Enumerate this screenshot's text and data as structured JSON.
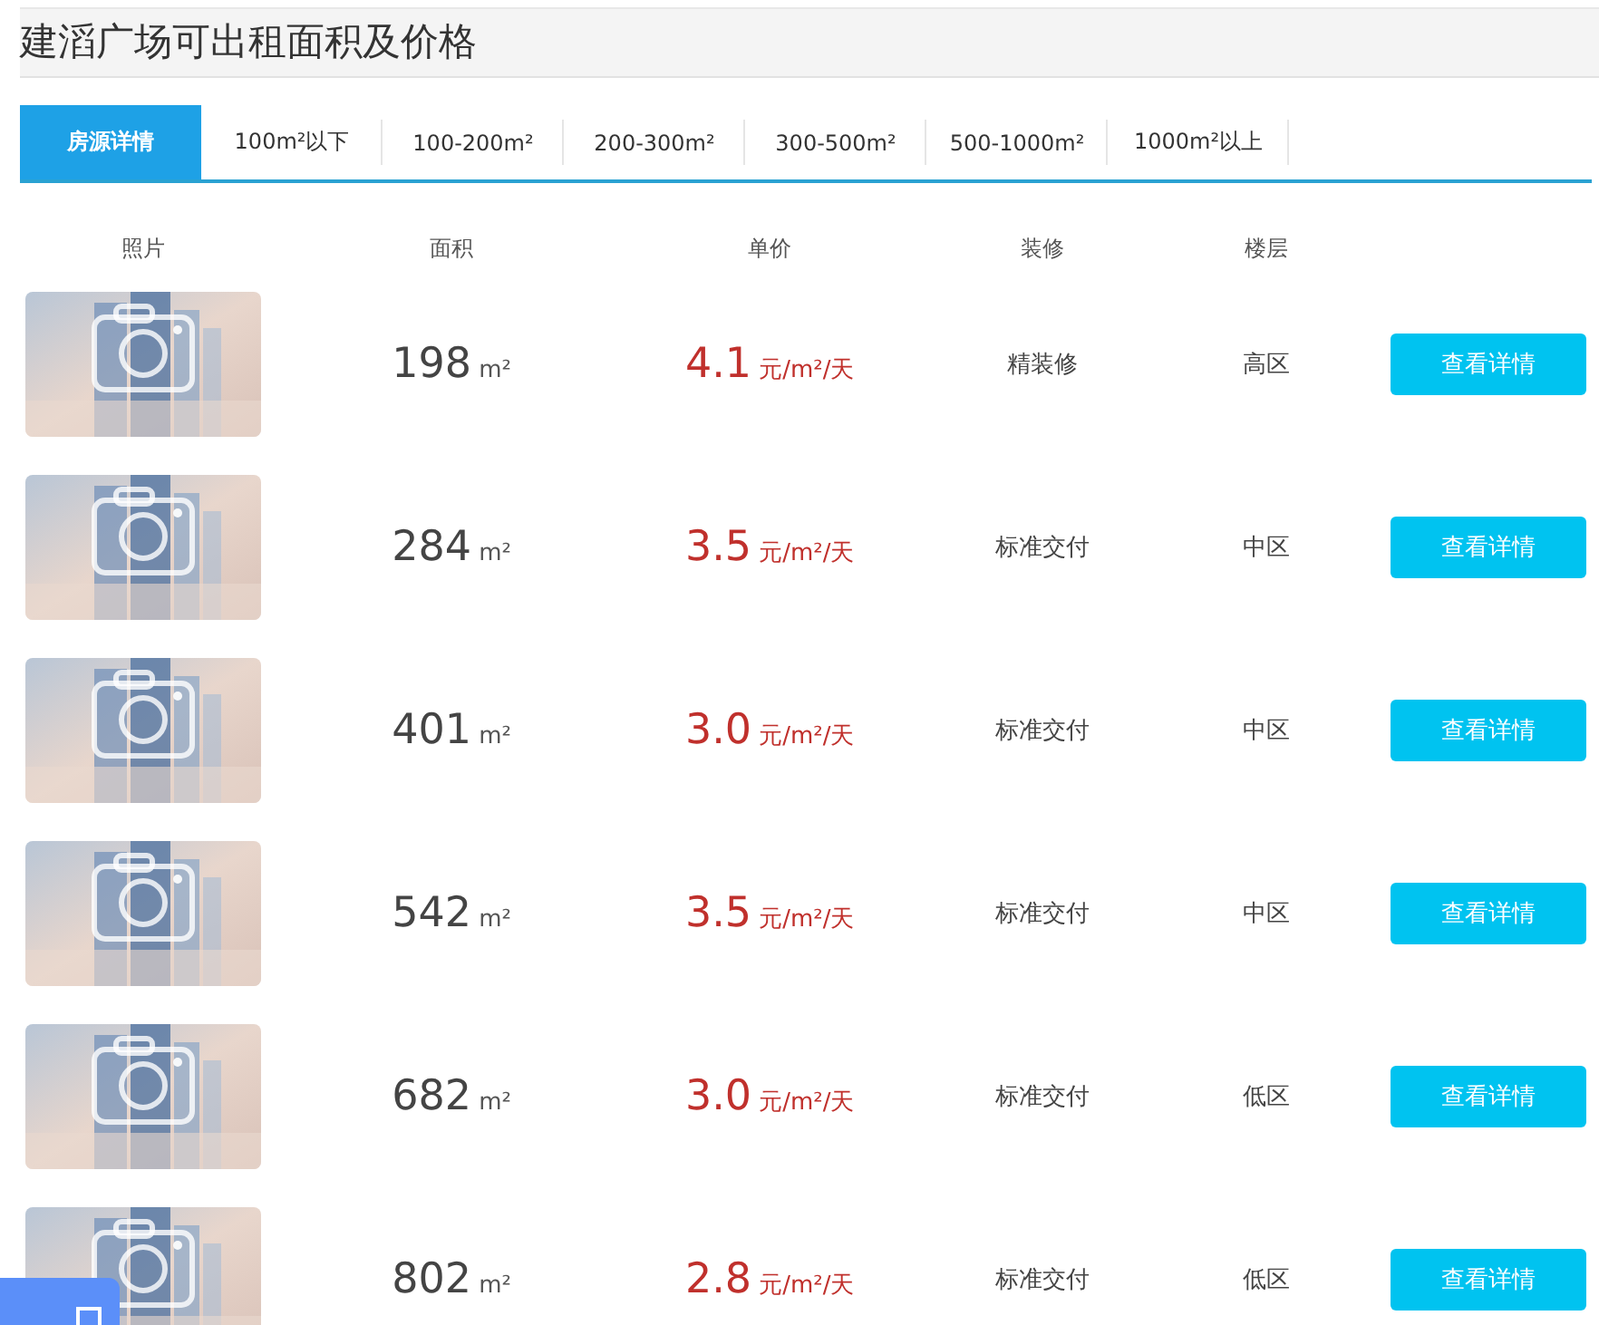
{
  "title": "建滔广场可出租面积及价格",
  "tabs": [
    {
      "label": "房源详情",
      "selected": true
    },
    {
      "label": "100m²以下",
      "selected": false
    },
    {
      "label": "100-200m²",
      "selected": false
    },
    {
      "label": "200-300m²",
      "selected": false
    },
    {
      "label": "300-500m²",
      "selected": false
    },
    {
      "label": "500-1000m²",
      "selected": false
    },
    {
      "label": "1000m²以上",
      "selected": false
    }
  ],
  "columns": [
    "照片",
    "面积",
    "单价",
    "装修",
    "楼层"
  ],
  "rows": [
    {
      "area": "198",
      "area_unit": "m²",
      "price": "4.1",
      "price_unit": "元/m²/天",
      "decoration": "精装修",
      "floor": "高区",
      "button": "查看详情"
    },
    {
      "area": "284",
      "area_unit": "m²",
      "price": "3.5",
      "price_unit": "元/m²/天",
      "decoration": "标准交付",
      "floor": "中区",
      "button": "查看详情"
    },
    {
      "area": "401",
      "area_unit": "m²",
      "price": "3.0",
      "price_unit": "元/m²/天",
      "decoration": "标准交付",
      "floor": "中区",
      "button": "查看详情"
    },
    {
      "area": "542",
      "area_unit": "m²",
      "price": "3.5",
      "price_unit": "元/m²/天",
      "decoration": "标准交付",
      "floor": "中区",
      "button": "查看详情"
    },
    {
      "area": "682",
      "area_unit": "m²",
      "price": "3.0",
      "price_unit": "元/m²/天",
      "decoration": "标准交付",
      "floor": "低区",
      "button": "查看详情"
    },
    {
      "area": "802",
      "area_unit": "m²",
      "price": "2.8",
      "price_unit": "元/m²/天",
      "decoration": "标准交付",
      "floor": "低区",
      "button": "查看详情"
    }
  ]
}
